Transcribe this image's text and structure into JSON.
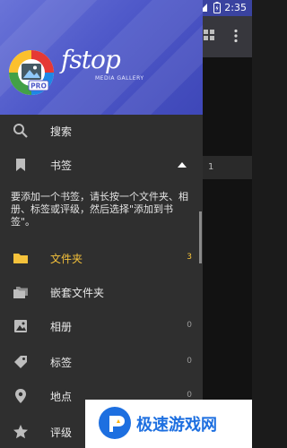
{
  "status_bar": {
    "time": "2:35"
  },
  "header": {
    "brand": "fstop",
    "brand_sub": "MEDIA GALLERY",
    "badge": "PRO"
  },
  "menu": {
    "search": "搜索",
    "bookmarks": "书签",
    "bookmark_hint": "要添加一个书签，请长按一个文件夹、相册、标签或评级，然后选择\"添加到书签\"。",
    "items": [
      {
        "label": "文件夹",
        "count": "3"
      },
      {
        "label": "嵌套文件夹",
        "count": ""
      },
      {
        "label": "相册",
        "count": "0"
      },
      {
        "label": "标签",
        "count": "0"
      },
      {
        "label": "地点",
        "count": "0"
      },
      {
        "label": "评级",
        "count": ""
      }
    ]
  },
  "background": {
    "row_number": "1"
  },
  "watermark": {
    "text": "极速游戏网"
  },
  "colors": {
    "accent": "#f5c23b",
    "header": "#4f59c9",
    "drawer": "#2f2f2f"
  }
}
